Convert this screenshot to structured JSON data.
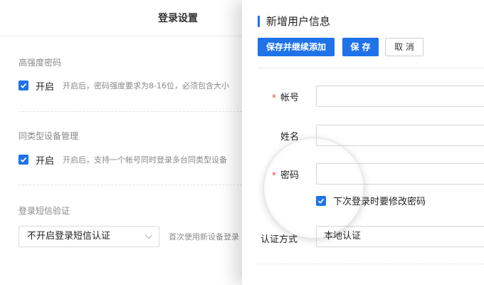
{
  "settings": {
    "title": "登录设置",
    "password_strength": {
      "section_label": "高强度密码",
      "option_label": "开启",
      "checked": true,
      "description": "开启后，密码强度要求为8-16位，必须包含大小"
    },
    "device_management": {
      "section_label": "同类型设备管理",
      "option_label": "开启",
      "checked": true,
      "description": "开启后，支持一个帐号同时登录多台同类型设备"
    },
    "sms_verification": {
      "section_label": "登录短信验证",
      "select_value": "不开启登录短信认证",
      "description": "首次使用新设备登录"
    }
  },
  "user_form": {
    "title": "新增用户信息",
    "buttons": {
      "save_and_add": "保存并继续添加",
      "save": "保 存",
      "cancel": "取 消"
    },
    "fields": {
      "account": {
        "required_mark": "*",
        "label": "帐号",
        "value": ""
      },
      "name": {
        "label": "姓名",
        "value": ""
      },
      "password": {
        "required_mark": "*",
        "label": "密码",
        "value": ""
      }
    },
    "change_password_next_login": {
      "label": "下次登录时要修改密码",
      "checked": true
    },
    "auth_method": {
      "label": "认证方式",
      "value": "本地认证"
    }
  },
  "colors": {
    "accent": "#1f72e8",
    "required": "#e43e3e"
  }
}
